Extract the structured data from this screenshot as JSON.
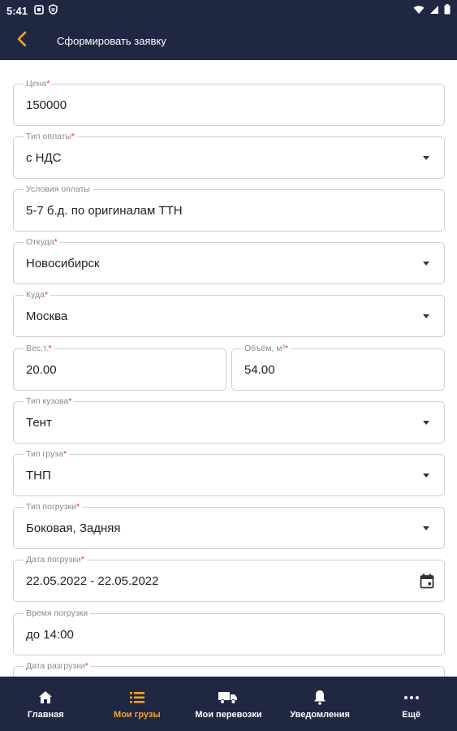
{
  "status_bar": {
    "time": "5:41"
  },
  "app_bar": {
    "title": "Сформировать заявку"
  },
  "form": {
    "price": {
      "label": "Цена",
      "value": "150000"
    },
    "payment_type": {
      "label": "Тип оплаты",
      "value": "с НДС"
    },
    "payment_terms": {
      "label": "Условия оплаты",
      "value": "5-7 б.д. по оригиналам ТТН"
    },
    "from": {
      "label": "Откуда",
      "value": "Новосибирск"
    },
    "to": {
      "label": "Куда",
      "value": "Москва"
    },
    "weight": {
      "label": "Вес,т.",
      "value": "20.00"
    },
    "volume": {
      "label": "Объём, м³",
      "value": "54.00"
    },
    "body_type": {
      "label": "Тип кузова",
      "value": "Тент"
    },
    "cargo_type": {
      "label": "Тип груза",
      "value": "ТНП"
    },
    "loading_type": {
      "label": "Тип погрузки",
      "value": "Боковая, Задняя"
    },
    "loading_date": {
      "label": "Дата погрузки",
      "value": "22.05.2022 - 22.05.2022"
    },
    "loading_time": {
      "label": "Время погрузки",
      "value": "до 14:00"
    },
    "unloading_date": {
      "label": "Дата разгрузки",
      "value": ""
    },
    "required_mark": "*"
  },
  "bottom_nav": {
    "items": [
      {
        "label": "Главная",
        "icon": "home-icon"
      },
      {
        "label": "Мои грузы",
        "icon": "list-icon",
        "active": true
      },
      {
        "label": "Мои перевозки",
        "icon": "truck-icon"
      },
      {
        "label": "Уведомления",
        "icon": "bell-icon"
      },
      {
        "label": "Ещё",
        "icon": "more-icon"
      }
    ]
  },
  "colors": {
    "primary_dark": "#1f2743",
    "accent": "#f5a623",
    "required": "#e0283a"
  }
}
